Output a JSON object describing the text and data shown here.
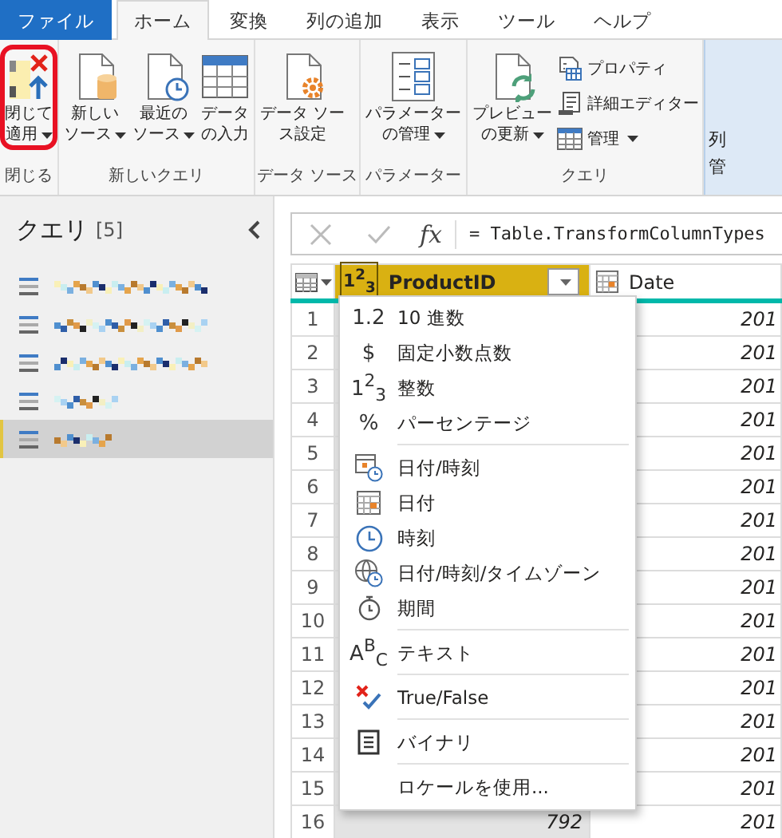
{
  "tabs": [
    {
      "label": "ファイル",
      "kind": "file",
      "selected": false
    },
    {
      "label": "ホーム",
      "kind": "tab",
      "selected": true
    },
    {
      "label": "変換",
      "kind": "tab",
      "selected": false
    },
    {
      "label": "列の追加",
      "kind": "tab",
      "selected": false
    },
    {
      "label": "表示",
      "kind": "tab",
      "selected": false
    },
    {
      "label": "ツール",
      "kind": "tab",
      "selected": false
    },
    {
      "label": "ヘルプ",
      "kind": "tab",
      "selected": false
    }
  ],
  "ribbon": {
    "groups": [
      {
        "label": "閉じる",
        "buttons": [
          {
            "kind": "close-apply",
            "lines": [
              "閉じて",
              "適用"
            ],
            "dropdown": true,
            "annotated": true
          }
        ]
      },
      {
        "label": "新しいクエリ",
        "buttons": [
          {
            "kind": "new-source",
            "lines": [
              "新しい",
              "ソース"
            ],
            "dropdown": true
          },
          {
            "kind": "recent-source",
            "lines": [
              "最近の",
              "ソース"
            ],
            "dropdown": true
          },
          {
            "kind": "enter-data",
            "lines": [
              "データ",
              "の入力"
            ],
            "dropdown": false
          }
        ]
      },
      {
        "label": "データ ソース",
        "buttons": [
          {
            "kind": "source-settings",
            "lines": [
              "データ ソー",
              "ス設定"
            ],
            "dropdown": false
          }
        ]
      },
      {
        "label": "パラメーター",
        "buttons": [
          {
            "kind": "manage-parameters",
            "lines": [
              "パラメーター",
              "の管理"
            ],
            "dropdown": true
          }
        ]
      },
      {
        "label": "クエリ",
        "buttons": [
          {
            "kind": "refresh-preview",
            "lines": [
              "プレビュー",
              "の更新"
            ],
            "dropdown": true
          },
          {
            "kind": "properties",
            "lines": [
              "プロパティ"
            ],
            "dropdown": false
          },
          {
            "kind": "advanced-editor",
            "lines": [
              "詳細エディター"
            ],
            "dropdown": false
          },
          {
            "kind": "manage",
            "lines": [
              "管理"
            ],
            "dropdown": true
          }
        ]
      }
    ],
    "partial_button": {
      "lines": [
        "列",
        "管"
      ]
    }
  },
  "queries": {
    "title": "クエリ",
    "count": "[5]",
    "items": [
      {
        "selected": false
      },
      {
        "selected": false
      },
      {
        "selected": false
      },
      {
        "selected": false
      },
      {
        "selected": true
      }
    ]
  },
  "formula": {
    "fx": "fx",
    "text": "= Table.TransformColumnTypes"
  },
  "grid": {
    "columns": [
      {
        "label": "ProductID",
        "kind": "whole",
        "type_symbol": "1$^{2}$$_{3}$",
        "selected": true
      },
      {
        "label": "Date",
        "kind": "date",
        "selected": false
      }
    ],
    "rows": [
      {
        "number": "1",
        "date": "201"
      },
      {
        "number": "2",
        "date": "201"
      },
      {
        "number": "3",
        "date": "201"
      },
      {
        "number": "4",
        "date": "201"
      },
      {
        "number": "5",
        "date": "201"
      },
      {
        "number": "6",
        "date": "201"
      },
      {
        "number": "7",
        "date": "201"
      },
      {
        "number": "8",
        "date": "201"
      },
      {
        "number": "9",
        "date": "201"
      },
      {
        "number": "10",
        "date": "201"
      },
      {
        "number": "11",
        "date": "201"
      },
      {
        "number": "12",
        "date": "201"
      },
      {
        "number": "13",
        "date": "201"
      },
      {
        "number": "14",
        "date": "201"
      },
      {
        "number": "15",
        "date": "201"
      },
      {
        "number": "16",
        "product_id": "792",
        "date": "201"
      }
    ]
  },
  "type_menu": {
    "items": [
      {
        "kind": "decimal",
        "symbol": "1.2",
        "label": "10 進数",
        "separator_before": false
      },
      {
        "kind": "currency",
        "symbol": "$",
        "label": "固定小数点数",
        "separator_before": false
      },
      {
        "kind": "whole",
        "symbol": "1$^{2}$$_{3}$",
        "label": "整数",
        "separator_before": false
      },
      {
        "kind": "percent",
        "symbol": "%",
        "label": "パーセンテージ",
        "separator_before": false
      },
      {
        "kind": "datetime",
        "label": "日付/時刻",
        "separator_before": true
      },
      {
        "kind": "date",
        "label": "日付",
        "separator_before": false
      },
      {
        "kind": "time",
        "label": "時刻",
        "separator_before": false
      },
      {
        "kind": "datetimezone",
        "label": "日付/時刻/タイムゾーン",
        "separator_before": false
      },
      {
        "kind": "duration",
        "label": "期間",
        "separator_before": false
      },
      {
        "kind": "text",
        "symbol": "A$^{B}$$_{C}$",
        "label": "テキスト",
        "separator_before": true
      },
      {
        "kind": "logical",
        "label": "True/False",
        "separator_before": true
      },
      {
        "kind": "binary",
        "label": "バイナリ",
        "separator_before": true
      },
      {
        "kind": "locale",
        "label": "ロケールを使用...",
        "separator_before": true
      }
    ]
  }
}
